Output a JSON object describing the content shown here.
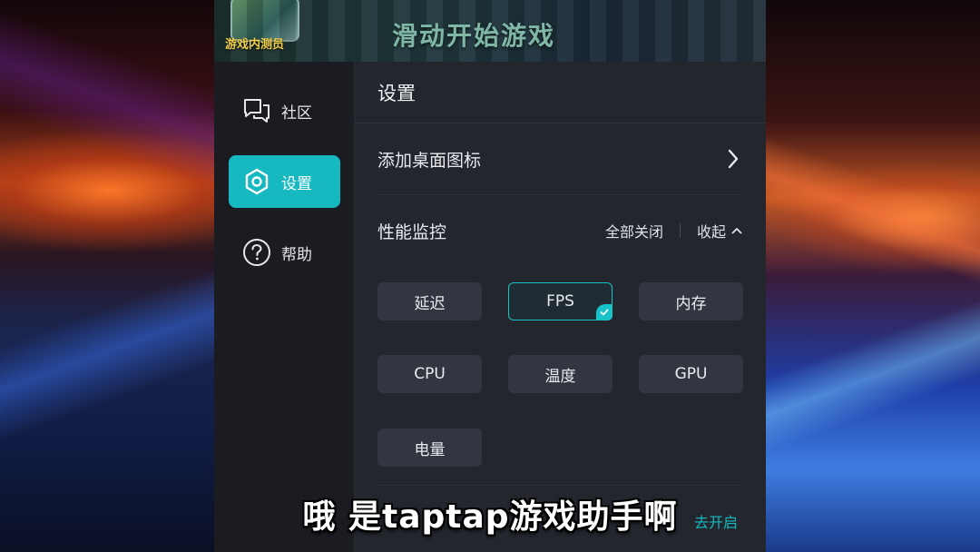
{
  "game": {
    "badge": "游戏内测员",
    "title": "滑动开始游戏"
  },
  "sidebar": {
    "items": [
      {
        "label": "社区",
        "icon": "chat-bubbles-icon",
        "active": false
      },
      {
        "label": "设置",
        "icon": "hexagon-settings-icon",
        "active": true
      },
      {
        "label": "帮助",
        "icon": "question-circle-icon",
        "active": false
      }
    ]
  },
  "panel": {
    "title": "设置",
    "shortcut_label": "添加桌面图标",
    "perf": {
      "title": "性能监控",
      "close_all": "全部关闭",
      "collapse": "收起"
    },
    "chips": [
      {
        "label": "延迟",
        "selected": false
      },
      {
        "label": "FPS",
        "selected": true
      },
      {
        "label": "内存",
        "selected": false
      },
      {
        "label": "CPU",
        "selected": false
      },
      {
        "label": "温度",
        "selected": false
      },
      {
        "label": "GPU",
        "selected": false
      },
      {
        "label": "电量",
        "selected": false
      }
    ],
    "enable_link": "去开启"
  },
  "subtitle": "哦 是taptap游戏助手啊",
  "colors": {
    "accent": "#16b9c0",
    "panel_bg": "#23262d",
    "sidebar_bg": "#1a1c22",
    "chip_bg": "#323640"
  }
}
